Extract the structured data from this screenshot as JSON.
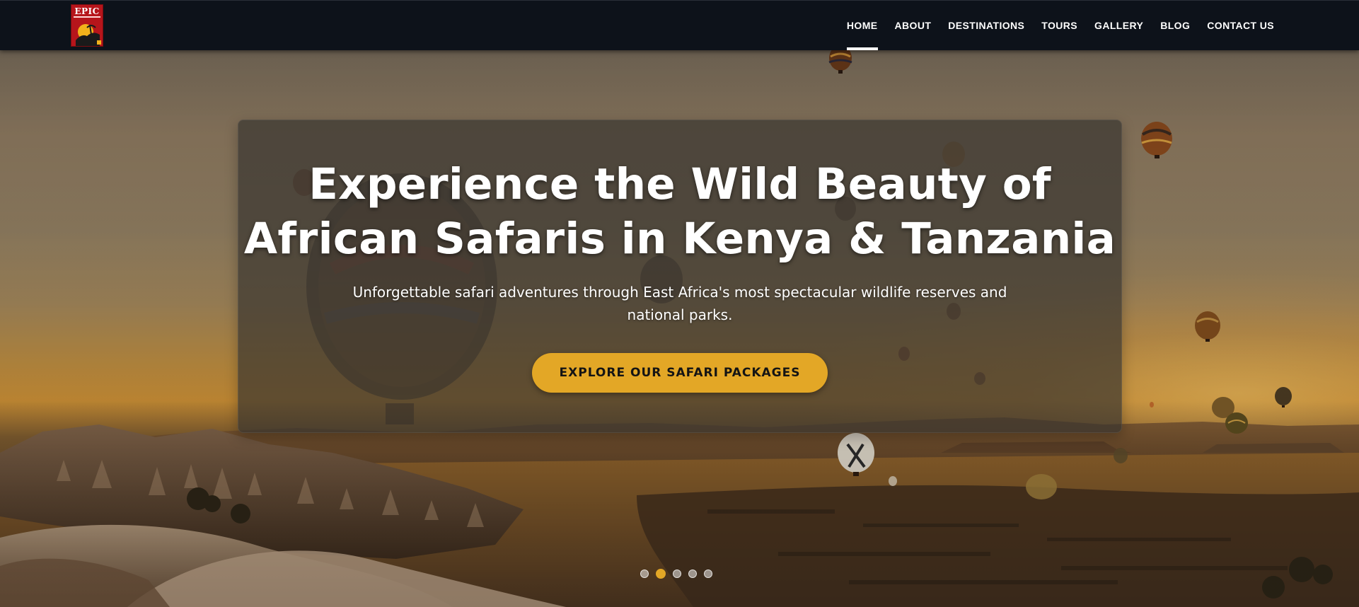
{
  "brand": {
    "logo_text": "EPIC",
    "logo_icon": "safari-logo-icon"
  },
  "nav": {
    "items": [
      {
        "label": "HOME",
        "active": true
      },
      {
        "label": "ABOUT",
        "active": false
      },
      {
        "label": "DESTINATIONS",
        "active": false
      },
      {
        "label": "TOURS",
        "active": false
      },
      {
        "label": "GALLERY",
        "active": false
      },
      {
        "label": "BLOG",
        "active": false
      },
      {
        "label": "CONTACT US",
        "active": false
      }
    ]
  },
  "hero": {
    "title_line1": "Experience the Wild Beauty of",
    "title_line2": "African Safaris in Kenya & Tanzania",
    "subtitle_line1": "Unforgettable safari adventures through East Africa's most spectacular wildlife reserves and",
    "subtitle_line2": "national parks.",
    "cta_label": "EXPLORE OUR SAFARI PACKAGES",
    "background_image": "hot-air-balloons-over-valley-at-sunset"
  },
  "slider": {
    "total_slides": 5,
    "active_index": 1
  },
  "colors": {
    "nav_background": "#0d121a",
    "accent": "#e3a726",
    "card_overlay": "rgba(55,52,47,0.68)",
    "text_primary": "#ffffff"
  }
}
